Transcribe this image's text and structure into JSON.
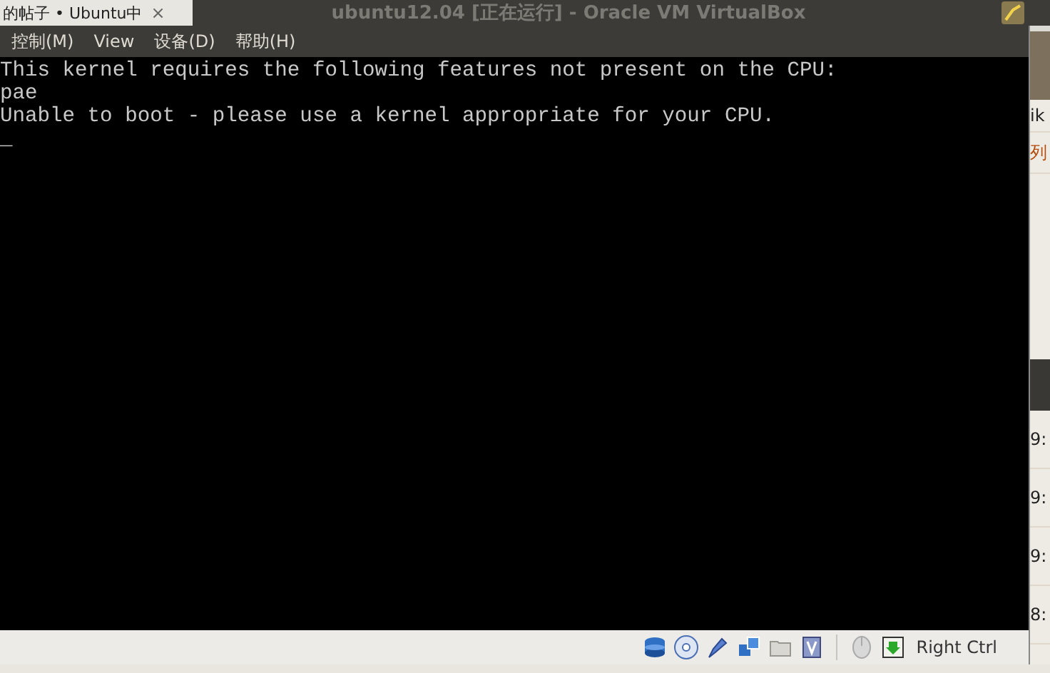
{
  "browser_tab": {
    "label": "的帖子 • Ubuntu中",
    "close": "×"
  },
  "window": {
    "title": "ubuntu12.04 [正在运行] - Oracle VM VirtualBox"
  },
  "menu": [
    {
      "label": "控制(M)"
    },
    {
      "label": "View"
    },
    {
      "label": "设备(D)"
    },
    {
      "label": "帮助(H)"
    }
  ],
  "console": {
    "lines": [
      "This kernel requires the following features not present on the CPU:",
      "pae",
      "Unable to boot - please use a kernel appropriate for your CPU."
    ],
    "cursor": "_"
  },
  "status_bar": {
    "host_key": "Right Ctrl"
  },
  "background_window": {
    "texts": [
      "ik",
      "列",
      "9:",
      "9:",
      "9:",
      "8:"
    ]
  }
}
